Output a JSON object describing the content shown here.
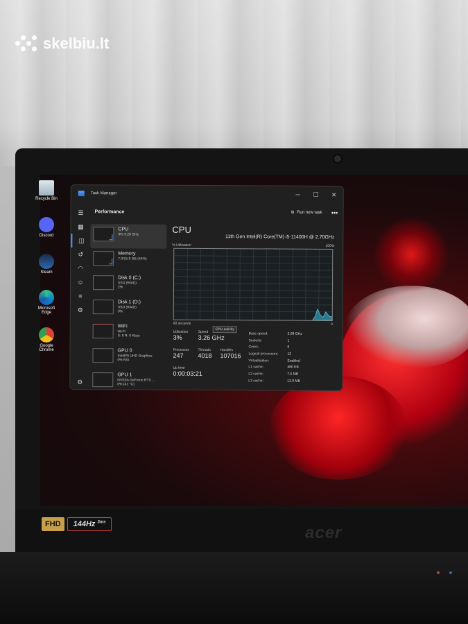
{
  "watermark": {
    "text": "skelbiu.lt"
  },
  "desktop": {
    "icons": [
      {
        "label": "Recycle Bin",
        "icon": "recycle-bin-icon"
      },
      {
        "label": "Discord",
        "icon": "discord-icon"
      },
      {
        "label": "Steam",
        "icon": "steam-icon"
      },
      {
        "label": "Microsoft Edge",
        "icon": "edge-icon"
      },
      {
        "label": "Google Chrome",
        "icon": "chrome-icon"
      }
    ]
  },
  "laptop": {
    "badge_fhd": "FHD",
    "badge_hz": "144Hz",
    "badge_hz_sub": "3ms",
    "brand": "acer"
  },
  "task_manager": {
    "title": "Task Manager",
    "window_controls": {
      "minimize": "─",
      "maximize": "☐",
      "close": "✕"
    },
    "section": "Performance",
    "run_new_task": "Run new task",
    "more": "•••",
    "rail_icons": [
      "hamburger-icon",
      "processes-icon",
      "performance-icon",
      "history-icon",
      "startup-icon",
      "users-icon",
      "details-icon",
      "services-icon"
    ],
    "settings_icon": "settings-icon",
    "list": [
      {
        "name": "CPU",
        "line1": "3%  3.26 GHz",
        "line2": ""
      },
      {
        "name": "Memory",
        "line1": "7.0/15.8 GB (44%)",
        "line2": ""
      },
      {
        "name": "Disk 0 (C:)",
        "line1": "SSD (RAID)",
        "line2": "2%"
      },
      {
        "name": "Disk 1 (D:)",
        "line1": "SSD (RAID)",
        "line2": "0%"
      },
      {
        "name": "WiFi",
        "line1": "Wi-Fi",
        "line2": "S: 0  R: 0 Kbps"
      },
      {
        "name": "GPU 0",
        "line1": "Intel(R) UHD Graphics",
        "line2": "0% N/A"
      },
      {
        "name": "GPU 1",
        "line1": "NVIDIA GeForce RTX ...",
        "line2": "0% (41 °C)"
      }
    ],
    "detail": {
      "title": "CPU",
      "model": "11th Gen Intel(R) Core(TM) i5-11400H @ 2.70GHz",
      "util_label": "% Utilisation",
      "util_max": "100%",
      "axis_left": "60 seconds",
      "axis_right": "0",
      "tooltip": "CPU activity",
      "utilization_label": "Utilisation",
      "utilization": "3%",
      "speed_label": "Speed",
      "speed": "3.26 GHz",
      "processes_label": "Processes",
      "processes": "247",
      "threads_label": "Threads",
      "threads": "4018",
      "handles_label": "Handles",
      "handles": "107016",
      "uptime_label": "Up time",
      "uptime": "0:00:03:21",
      "specs": [
        {
          "k": "Base speed:",
          "v": "2.69 GHz"
        },
        {
          "k": "Sockets:",
          "v": "1"
        },
        {
          "k": "Cores:",
          "v": "6"
        },
        {
          "k": "Logical processors:",
          "v": "12"
        },
        {
          "k": "Virtualisation:",
          "v": "Enabled"
        },
        {
          "k": "L1 cache:",
          "v": "480 KB"
        },
        {
          "k": "L2 cache:",
          "v": "7.5 MB"
        },
        {
          "k": "L3 cache:",
          "v": "12.0 MB"
        }
      ]
    }
  }
}
